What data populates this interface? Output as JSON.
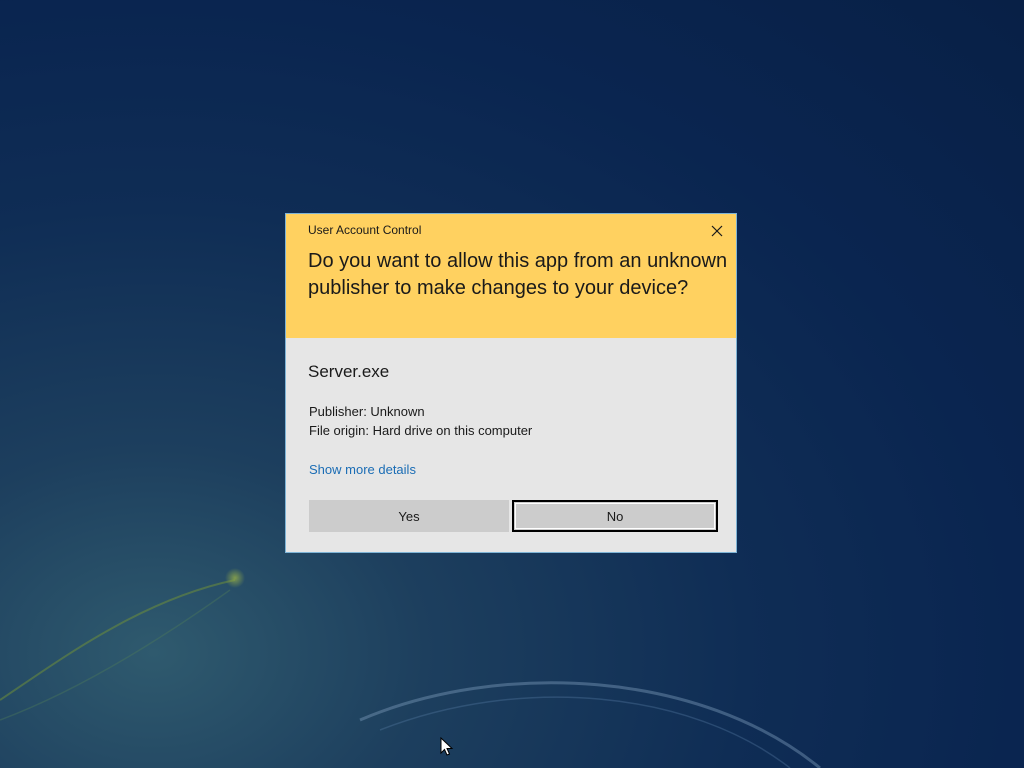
{
  "dialog": {
    "caption": "User Account Control",
    "question": "Do you want to allow this app from an unknown publisher to make changes to your device?",
    "app_name": "Server.exe",
    "publisher": "Publisher: Unknown",
    "file_origin": "File origin: Hard drive on this computer",
    "details_link": "Show more details",
    "yes_label": "Yes",
    "no_label": "No"
  },
  "icons": {
    "close": "close-icon",
    "cursor": "mouse-pointer-icon"
  },
  "colors": {
    "header_bg": "#ffd160",
    "body_bg": "#e6e6e6",
    "button_bg": "#cccccc",
    "link": "#1b6db5",
    "dialog_border": "#7eb4d6"
  }
}
